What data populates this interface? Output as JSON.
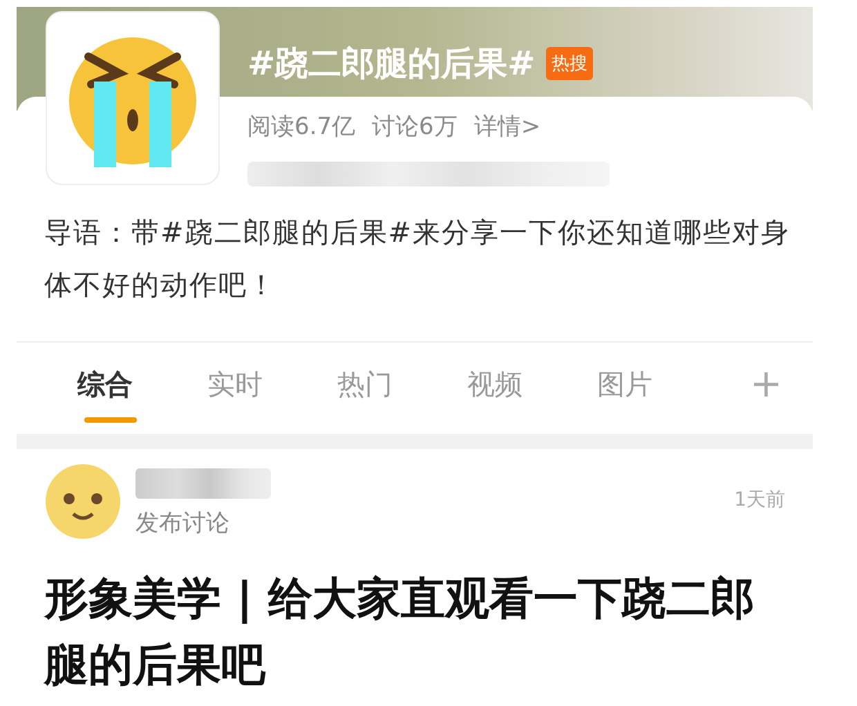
{
  "topic": {
    "title": "#跷二郎腿的后果#",
    "badge": "热搜",
    "stats": [
      "阅读6.7亿",
      "讨论6万",
      "详情>"
    ]
  },
  "intro": "导语：带#跷二郎腿的后果#来分享一下你还知道哪些对身体不好的动作吧！",
  "tabs": [
    {
      "label": "综合",
      "selected": true
    },
    {
      "label": "实时",
      "selected": false
    },
    {
      "label": "热门",
      "selected": false
    },
    {
      "label": "视频",
      "selected": false
    },
    {
      "label": "图片",
      "selected": false
    }
  ],
  "add_tab": "+",
  "post": {
    "action": "发布讨论",
    "time": "1天前",
    "title": "形象美学 | 给大家直观看一下跷二郎腿的后果吧"
  }
}
